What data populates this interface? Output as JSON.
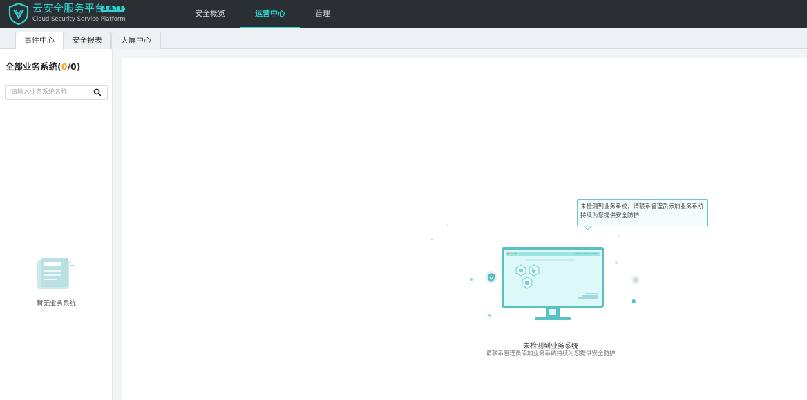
{
  "header": {
    "brand_title": "云安全服务平台",
    "brand_version": "4.0.11",
    "brand_subtitle": "Cloud Security Service Platform",
    "nav": [
      {
        "label": "安全概览",
        "active": false
      },
      {
        "label": "运营中心",
        "active": true
      },
      {
        "label": "管理",
        "active": false
      }
    ]
  },
  "tabs": [
    {
      "label": "事件中心",
      "active": true
    },
    {
      "label": "安全报表",
      "active": false
    },
    {
      "label": "大屏中心",
      "active": false
    }
  ],
  "sidebar": {
    "title": "全部业务系统",
    "count_open": "(",
    "count_current": "0",
    "count_sep": "/",
    "count_total": "0",
    "count_close": ")",
    "search_placeholder": "请输入业务系统名称",
    "search_icon": "search-icon",
    "empty_text": "暂无业务系统"
  },
  "main": {
    "bubble_text": "未检测到业务系统，请联系管理员添加业务系统持续为您提供安全防护",
    "empty_title": "未检测到业务系统",
    "empty_subtitle": "请联系管理员添加业务系统持续为您提供安全防护"
  },
  "colors": {
    "accent": "#2fd1d1",
    "header_bg": "#292f33",
    "count_highlight": "#f5a623"
  }
}
